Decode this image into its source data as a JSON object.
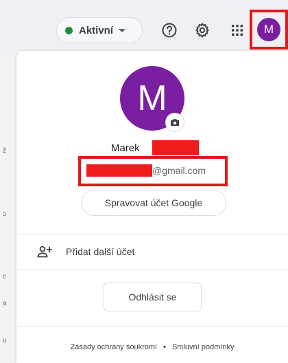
{
  "toolbar": {
    "status_label": "Aktivní",
    "status_color": "#1e8e3e",
    "icons": [
      "help-icon",
      "settings-gear-icon",
      "apps-grid-icon"
    ],
    "avatar_letter": "M"
  },
  "account": {
    "avatar_letter": "M",
    "avatar_color": "#7b1fa2",
    "name": "Marek",
    "email_suffix": "@gmail.com",
    "manage_label": "Spravovat účet Google",
    "add_account_label": "Přidat další účet",
    "signout_label": "Odhlásit se"
  },
  "footer": {
    "privacy_label": "Zásady ochrany soukromí",
    "separator": "•",
    "terms_label": "Smluvní podmínky"
  },
  "annotations": {
    "highlight_color": "#e0191c"
  },
  "background": {
    "edge_glyphs": [
      "ž",
      "ɔ",
      "c",
      "a",
      "u"
    ]
  }
}
